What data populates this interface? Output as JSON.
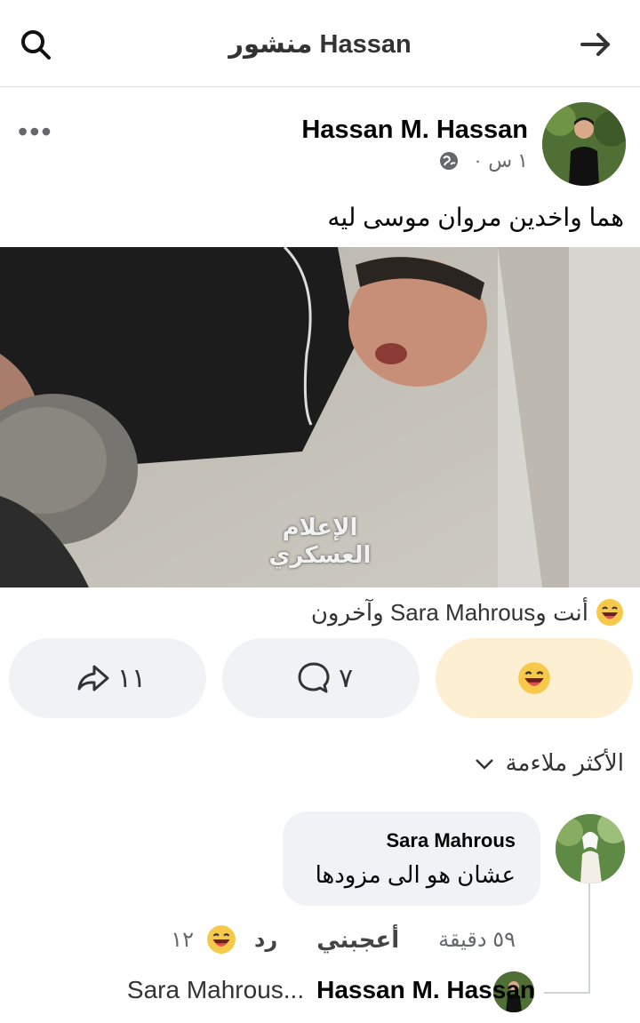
{
  "header": {
    "title": "منشور Hassan",
    "search_icon": "search-icon",
    "back_icon": "arrow-right-icon"
  },
  "post": {
    "author": "Hassan M. Hassan",
    "time": "١ س",
    "audience_icon": "globe-icon",
    "text": "هما واخدين مروان موسى ليه",
    "image_caption": "الإعلام العسكري",
    "more_icon": "more-dots-icon"
  },
  "reactions": {
    "summary": "أنت وSara Mahrous وآخرون",
    "emoji": "laugh-emoji-icon"
  },
  "actions": {
    "share_count": "١١",
    "comment_count": "٧",
    "react_emoji": "laugh-emoji-icon"
  },
  "comments": {
    "sort_label": "الأكثر ملاءمة",
    "items": [
      {
        "name": "Sara Mahrous",
        "text": "عشان هو الى مزودها",
        "time": "٥٩ دقيقة",
        "like_label": "أعجبني",
        "reply_label": "رد",
        "reaction_count": "١٢"
      }
    ],
    "reply_preview": {
      "name": "Hassan M. Hassan",
      "text": "Sara Mahrous..."
    }
  },
  "colors": {
    "accent_react_bg": "#fdf0d2",
    "button_bg": "#f0f2f5",
    "muted_text": "#65676b"
  }
}
